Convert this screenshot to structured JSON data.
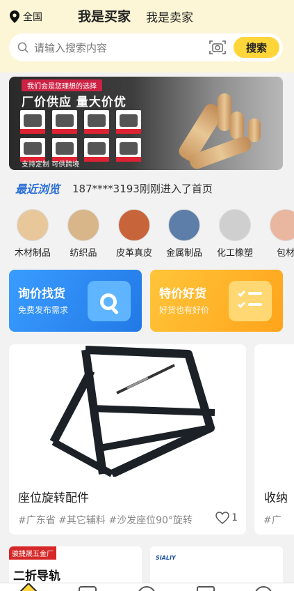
{
  "header": {
    "location": "全国",
    "tabs": [
      {
        "label": "我是买家",
        "active": true
      },
      {
        "label": "我是卖家",
        "active": false
      }
    ]
  },
  "search": {
    "placeholder": "请输入搜索内容",
    "button": "搜索"
  },
  "banner": {
    "tagline": "我们会是您理想的选择",
    "headline": "厂价供应 量大价优",
    "support": "支持定制 可供跨境"
  },
  "recent": {
    "title": "最近浏览",
    "message": "187****3193刚刚进入了首页"
  },
  "categories": [
    {
      "label": "木材制品",
      "icon": "wood-icon",
      "color": "#e8c79a"
    },
    {
      "label": "纺织品",
      "icon": "textile-icon",
      "color": "#d9b58a"
    },
    {
      "label": "皮革真皮",
      "icon": "leather-icon",
      "color": "#c8643a"
    },
    {
      "label": "金属制品",
      "icon": "metal-icon",
      "color": "#5d7ea8"
    },
    {
      "label": "化工橡塑",
      "icon": "plastic-icon",
      "color": "#cfcfcf"
    },
    {
      "label": "包材",
      "icon": "packaging-icon",
      "color": "#e9b6a0"
    }
  ],
  "promos": [
    {
      "title": "询价找货",
      "subtitle": "免费发布需求",
      "color": "#2f8ff2"
    },
    {
      "title": "特价好货",
      "subtitle": "好货也有好价",
      "color": "#ffb020"
    }
  ],
  "products": [
    {
      "name": "座位旋转配件",
      "tags": "#广东省 #其它辅料 #沙发座位90°旋转",
      "likes": "1"
    },
    {
      "name": "收纳",
      "tags": "#广"
    }
  ],
  "bottom_cards": [
    {
      "badge": "骏捷晟五金厂",
      "text": "二折导轨"
    },
    {
      "logo": "SIALIY"
    }
  ]
}
